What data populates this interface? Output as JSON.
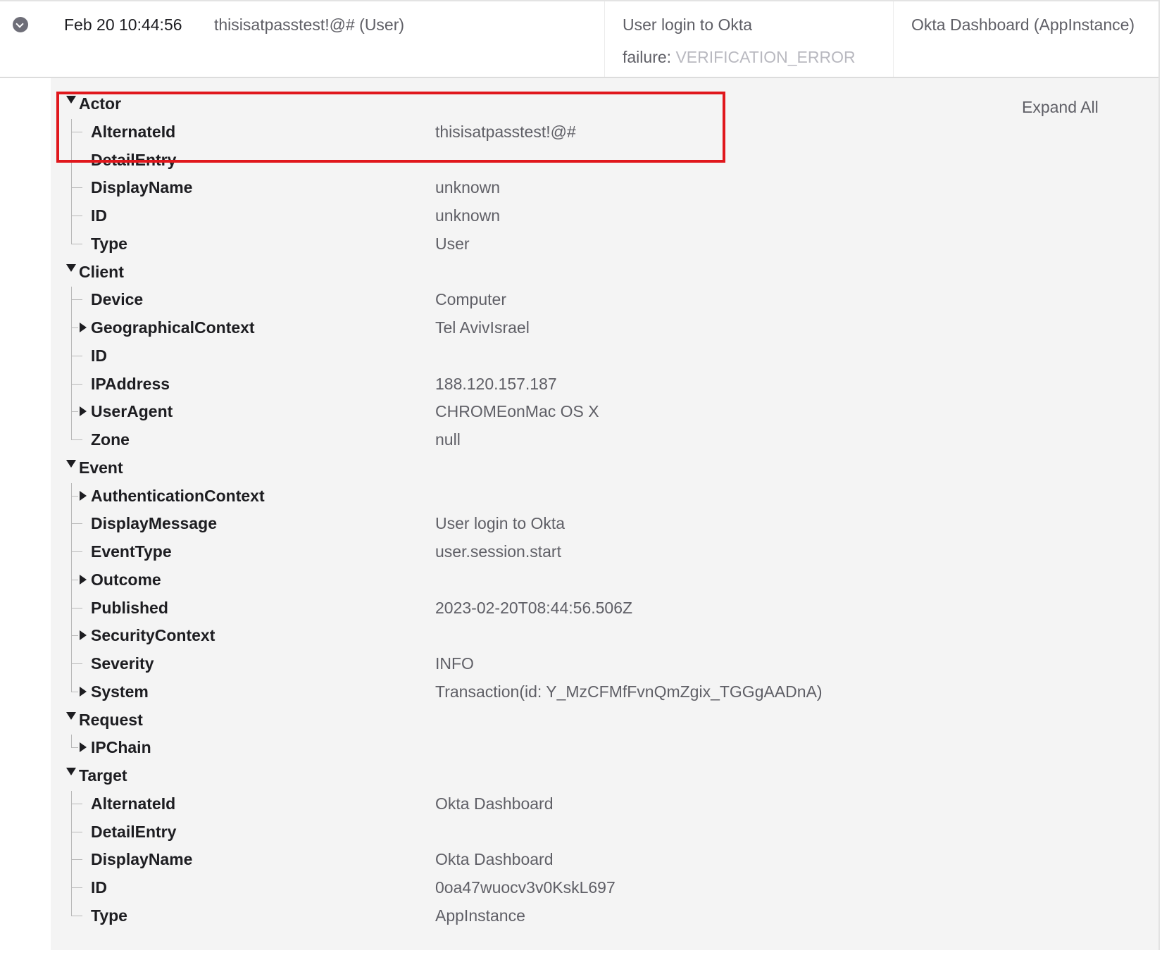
{
  "event": {
    "time": "Feb 20 10:44:56",
    "actor": "thisisatpasstest!@# (User)",
    "event_info": "User login to Okta",
    "outcome_label": "failure:",
    "outcome_reason": "VERIFICATION_ERROR",
    "target": "Okta Dashboard  (AppInstance)"
  },
  "details": {
    "expand_all": "Expand All",
    "sections": [
      {
        "label": "Actor",
        "fields": [
          {
            "key": "AlternateId",
            "value": "thisisatpasstest!@#",
            "expandable": false
          },
          {
            "key": "DetailEntry",
            "value": "",
            "expandable": false
          },
          {
            "key": "DisplayName",
            "value": "unknown",
            "expandable": false
          },
          {
            "key": "ID",
            "value": "unknown",
            "expandable": false
          },
          {
            "key": "Type",
            "value": "User",
            "expandable": false
          }
        ]
      },
      {
        "label": "Client",
        "fields": [
          {
            "key": "Device",
            "value": "Computer",
            "expandable": false
          },
          {
            "key": "GeographicalContext",
            "value": "Tel AvivIsrael",
            "expandable": true
          },
          {
            "key": "ID",
            "value": "",
            "expandable": false
          },
          {
            "key": "IPAddress",
            "value": "188.120.157.187",
            "expandable": false
          },
          {
            "key": "UserAgent",
            "value": "CHROMEonMac OS X",
            "expandable": true
          },
          {
            "key": "Zone",
            "value": "null",
            "expandable": false
          }
        ]
      },
      {
        "label": "Event",
        "fields": [
          {
            "key": "AuthenticationContext",
            "value": "",
            "expandable": true
          },
          {
            "key": "DisplayMessage",
            "value": "User login to Okta",
            "expandable": false
          },
          {
            "key": "EventType",
            "value": "user.session.start",
            "expandable": false
          },
          {
            "key": "Outcome",
            "value": "",
            "expandable": true
          },
          {
            "key": "Published",
            "value": "2023-02-20T08:44:56.506Z",
            "expandable": false
          },
          {
            "key": "SecurityContext",
            "value": "",
            "expandable": true
          },
          {
            "key": "Severity",
            "value": "INFO",
            "expandable": false
          },
          {
            "key": "System",
            "value": "Transaction(id: Y_MzCFMfFvnQmZgix_TGGgAADnA)",
            "expandable": true
          }
        ]
      },
      {
        "label": "Request",
        "fields": [
          {
            "key": "IPChain",
            "value": "",
            "expandable": true
          }
        ]
      },
      {
        "label": "Target",
        "fields": [
          {
            "key": "AlternateId",
            "value": "Okta Dashboard",
            "expandable": false
          },
          {
            "key": "DetailEntry",
            "value": "",
            "expandable": false
          },
          {
            "key": "DisplayName",
            "value": "Okta Dashboard",
            "expandable": false
          },
          {
            "key": "ID",
            "value": "0oa47wuocv3v0KskL697",
            "expandable": false
          },
          {
            "key": "Type",
            "value": "AppInstance",
            "expandable": false
          }
        ]
      }
    ]
  },
  "colors": {
    "highlight": "#e0171c",
    "panel_bg": "#f4f4f4",
    "muted_text": "#5f5f66"
  }
}
